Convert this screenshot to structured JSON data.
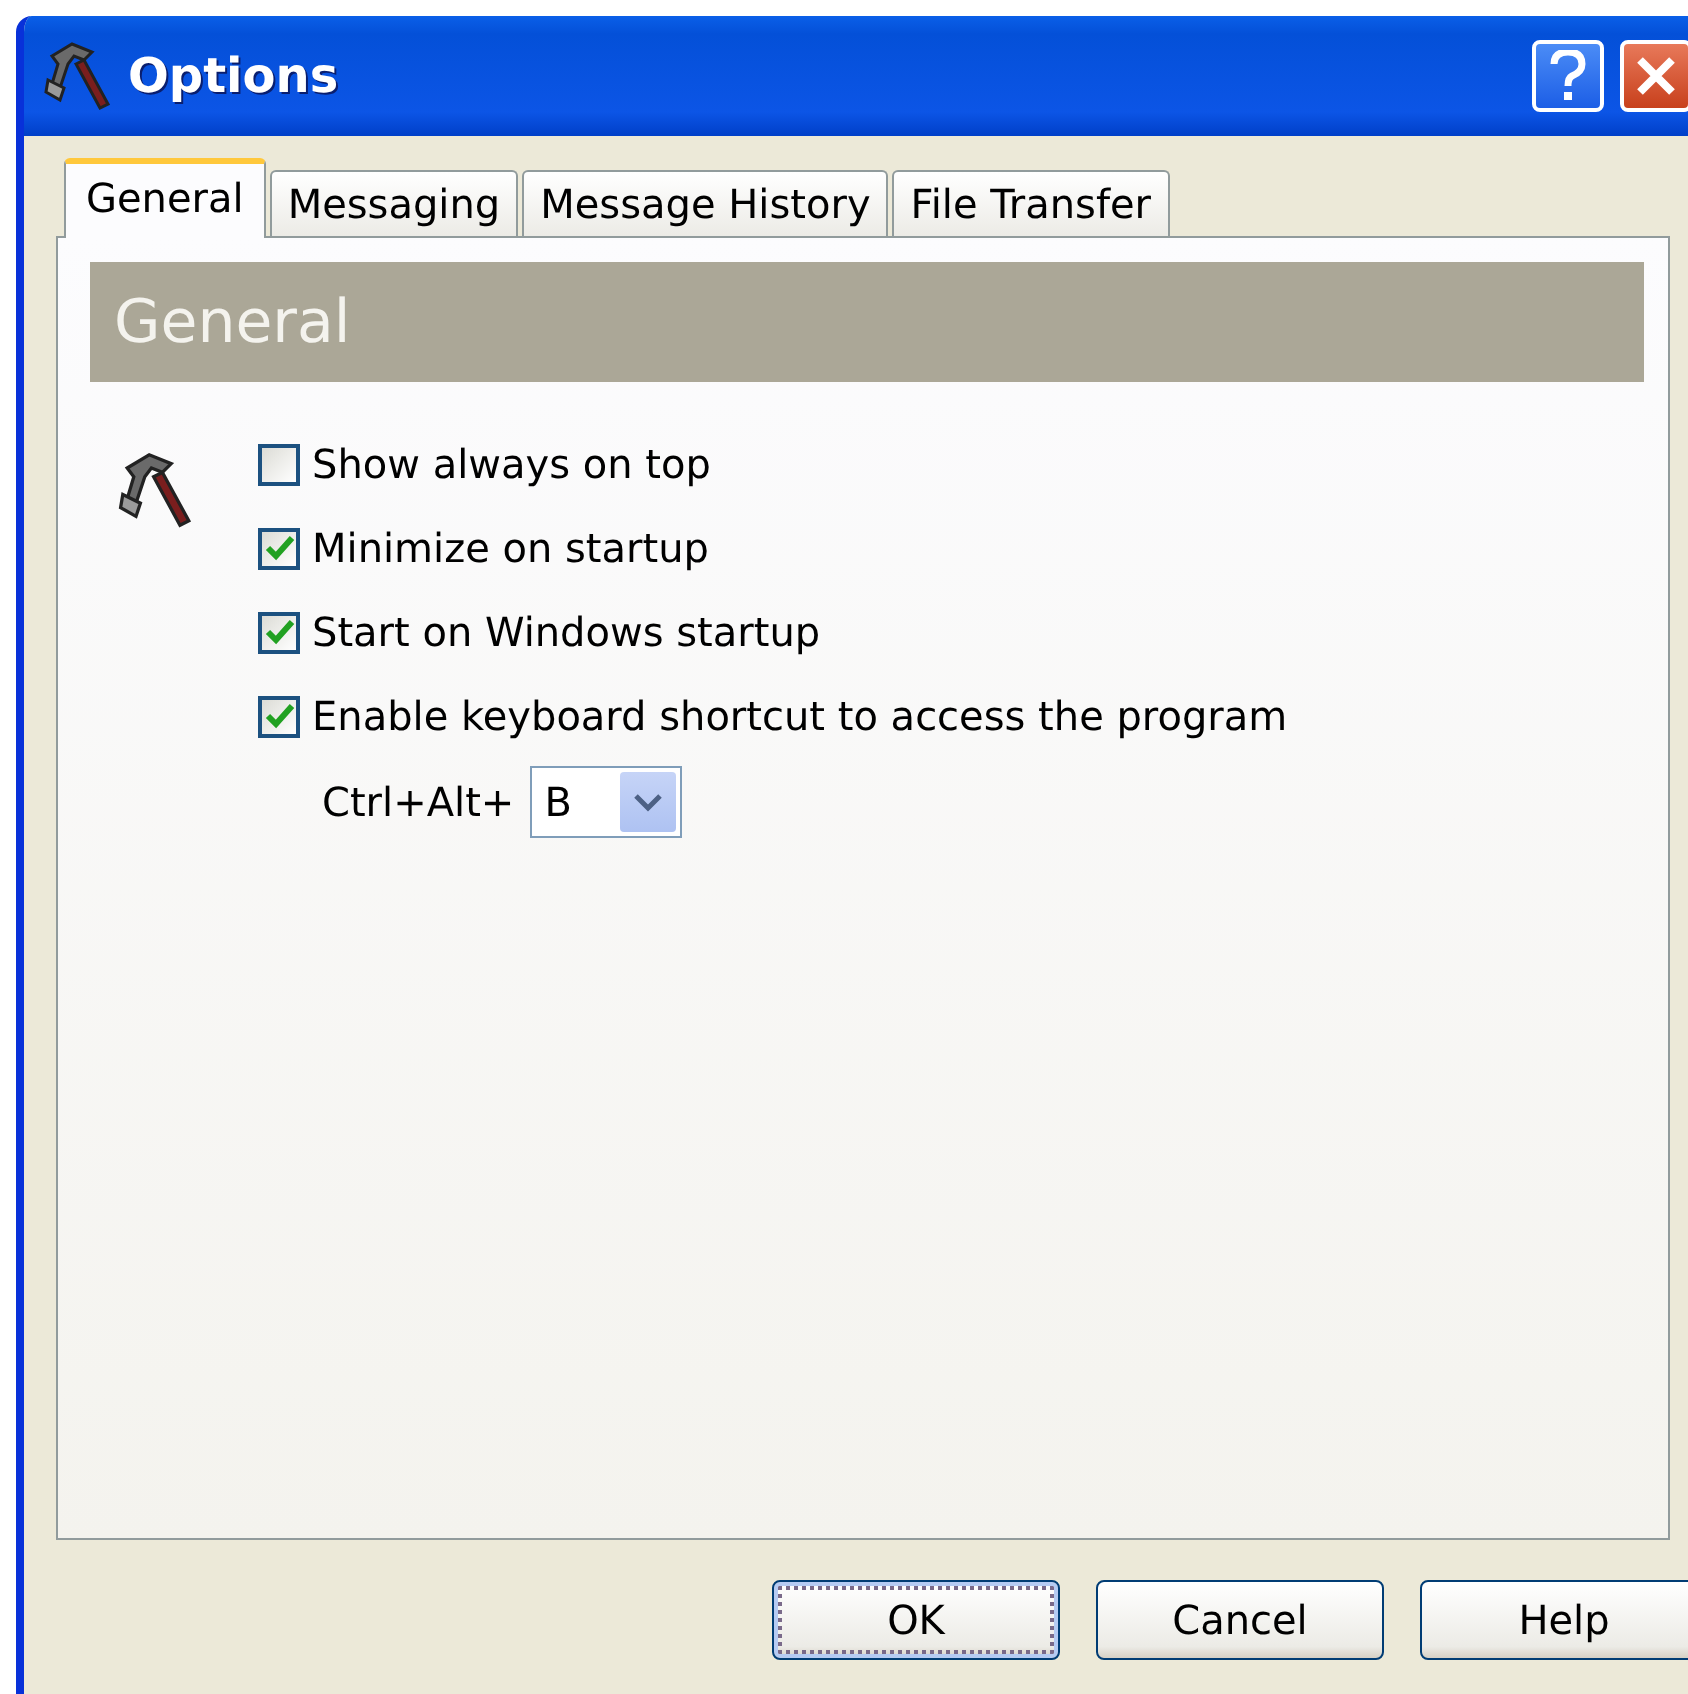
{
  "window": {
    "title": "Options"
  },
  "tabs": [
    {
      "label": "General",
      "selected": true
    },
    {
      "label": "Messaging",
      "selected": false
    },
    {
      "label": "Message History",
      "selected": false
    },
    {
      "label": "File Transfer",
      "selected": false
    }
  ],
  "section": {
    "title": "General"
  },
  "options": [
    {
      "label": "Show always on top",
      "checked": false
    },
    {
      "label": "Minimize on startup",
      "checked": true
    },
    {
      "label": "Start on Windows startup",
      "checked": true
    },
    {
      "label": "Enable keyboard shortcut to access the program",
      "checked": true
    }
  ],
  "shortcut": {
    "label": "Ctrl+Alt+",
    "value": "B"
  },
  "buttons": [
    {
      "label": "OK",
      "focused": true
    },
    {
      "label": "Cancel",
      "focused": false
    },
    {
      "label": "Help",
      "focused": false
    }
  ]
}
